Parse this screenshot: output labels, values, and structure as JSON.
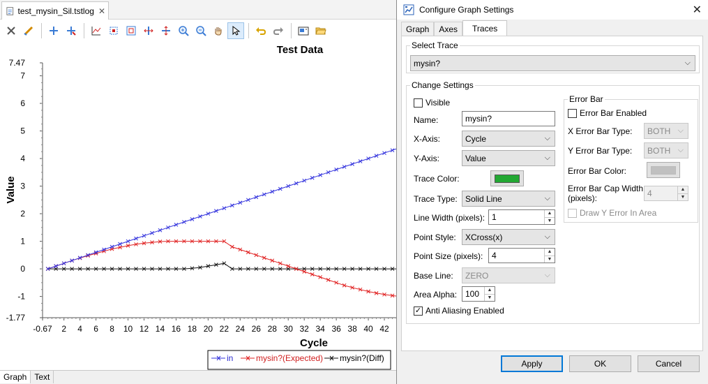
{
  "editor": {
    "tab_title": "test_mysin_Sil.tstlog",
    "bottom_tabs": [
      "Graph",
      "Text"
    ]
  },
  "toolbar": {
    "icons": [
      "tools-icon",
      "pen-icon",
      "add-point-icon",
      "remove-point-icon",
      "auto-scale-icon",
      "zoom-box-icon",
      "zoom-fit-icon",
      "zoom-x-icon",
      "zoom-y-icon",
      "zoom-in-icon",
      "zoom-out-icon",
      "pan-icon",
      "pointer-icon",
      "undo-icon",
      "redo-icon",
      "screenshot-icon",
      "open-folder-icon"
    ],
    "active": "pointer-icon"
  },
  "chart_data": {
    "type": "line",
    "title": "Test Data",
    "xlabel": "Cycle",
    "ylabel": "Value",
    "xlim": [
      -0.67,
      44
    ],
    "ylim": [
      -1.77,
      7.47
    ],
    "x_ticks": [
      "-0.67",
      "2",
      "4",
      "6",
      "8",
      "10",
      "12",
      "14",
      "16",
      "18",
      "20",
      "22",
      "24",
      "26",
      "28",
      "30",
      "32",
      "34",
      "36",
      "38",
      "40",
      "42",
      "4"
    ],
    "y_ticks": [
      "7.47",
      "7",
      "6",
      "5",
      "4",
      "3",
      "2",
      "1",
      "0",
      "-1",
      "-1.77"
    ],
    "legend_position": "bottom-right",
    "series": [
      {
        "name": "in",
        "color": "#3333dd",
        "marker": "x",
        "x": [
          0,
          1,
          2,
          3,
          4,
          5,
          6,
          7,
          8,
          9,
          10,
          11,
          12,
          13,
          14,
          15,
          16,
          17,
          18,
          19,
          20,
          21,
          22,
          23,
          24,
          25,
          26,
          27,
          28,
          29,
          30,
          31,
          32,
          33,
          34,
          35,
          36,
          37,
          38,
          39,
          40,
          41,
          42,
          43,
          44
        ],
        "y": [
          0,
          0.1,
          0.2,
          0.3,
          0.4,
          0.5,
          0.6,
          0.7,
          0.8,
          0.9,
          1,
          1.1,
          1.2,
          1.3,
          1.4,
          1.5,
          1.6,
          1.7,
          1.8,
          1.9,
          2,
          2.1,
          2.2,
          2.3,
          2.4,
          2.5,
          2.6,
          2.7,
          2.8,
          2.9,
          3,
          3.1,
          3.2,
          3.3,
          3.4,
          3.5,
          3.6,
          3.7,
          3.8,
          3.9,
          4,
          4.1,
          4.2,
          4.3,
          4.4
        ]
      },
      {
        "name": "mysin?(Expected)",
        "color": "#e02020",
        "marker": "x",
        "x": [
          0,
          1,
          2,
          3,
          4,
          5,
          6,
          7,
          8,
          9,
          10,
          11,
          12,
          13,
          14,
          15,
          16,
          17,
          18,
          19,
          20,
          21,
          22,
          23,
          24,
          25,
          26,
          27,
          28,
          29,
          30,
          31,
          32,
          33,
          34,
          35,
          36,
          37,
          38,
          39,
          40,
          41,
          42,
          43,
          44
        ],
        "y": [
          0,
          0.1,
          0.2,
          0.3,
          0.39,
          0.48,
          0.56,
          0.64,
          0.72,
          0.78,
          0.84,
          0.89,
          0.93,
          0.96,
          0.99,
          1,
          1,
          1,
          1,
          1,
          1,
          1,
          1,
          0.8,
          0.7,
          0.6,
          0.5,
          0.4,
          0.3,
          0.2,
          0.1,
          0,
          -0.1,
          -0.2,
          -0.3,
          -0.4,
          -0.5,
          -0.6,
          -0.68,
          -0.75,
          -0.82,
          -0.88,
          -0.93,
          -0.97,
          -1
        ]
      },
      {
        "name": "mysin?(Diff)",
        "color": "#111111",
        "marker": "x",
        "x": [
          0,
          1,
          2,
          3,
          4,
          5,
          6,
          7,
          8,
          9,
          10,
          11,
          12,
          13,
          14,
          15,
          16,
          17,
          18,
          19,
          20,
          21,
          22,
          23,
          24,
          25,
          26,
          27,
          28,
          29,
          30,
          31,
          32,
          33,
          34,
          35,
          36,
          37,
          38,
          39,
          40,
          41,
          42,
          43,
          44
        ],
        "y": [
          0,
          0,
          0,
          0,
          0,
          0,
          0,
          0,
          0,
          0,
          0,
          0,
          0,
          0,
          0,
          0,
          0,
          0,
          0.02,
          0.05,
          0.1,
          0.15,
          0.2,
          0,
          0,
          0,
          0,
          0,
          0,
          0,
          0,
          0,
          0,
          0,
          0,
          0,
          0,
          0,
          0,
          0,
          0,
          0,
          0,
          0,
          0
        ]
      }
    ]
  },
  "dialog": {
    "title": "Configure Graph Settings",
    "tabs": [
      "Graph",
      "Axes",
      "Traces"
    ],
    "active_tab": "Traces",
    "select_trace": {
      "title": "Select Trace",
      "value": "mysin?"
    },
    "change_settings": {
      "title": "Change Settings",
      "visible_label": "Visible",
      "visible_checked": false,
      "name_label": "Name:",
      "name_value": "mysin?",
      "x_axis_label": "X-Axis:",
      "x_axis_value": "Cycle",
      "y_axis_label": "Y-Axis:",
      "y_axis_value": "Value",
      "trace_color_label": "Trace Color:",
      "trace_color": "#22a833",
      "trace_type_label": "Trace Type:",
      "trace_type_value": "Solid Line",
      "line_width_label": "Line Width (pixels):",
      "line_width_value": "1",
      "point_style_label": "Point Style:",
      "point_style_value": "XCross(x)",
      "point_size_label": "Point Size (pixels):",
      "point_size_value": "4",
      "base_line_label": "Base Line:",
      "base_line_value": "ZERO",
      "area_alpha_label": "Area Alpha:",
      "area_alpha_value": "100",
      "anti_aliasing_label": "Anti Aliasing Enabled",
      "anti_aliasing_checked": true
    },
    "error_bar": {
      "title": "Error Bar",
      "enabled_label": "Error Bar Enabled",
      "enabled_checked": false,
      "x_type_label": "X Error Bar Type:",
      "x_type_value": "BOTH",
      "y_type_label": "Y Error Bar Type:",
      "y_type_value": "BOTH",
      "color_label": "Error Bar Color:",
      "color": "#c0c0c0",
      "cap_width_label_line1": "Error Bar Cap Width",
      "cap_width_label_line2": "(pixels):",
      "cap_width_value": "4",
      "draw_y_label": "Draw Y Error In Area",
      "draw_y_checked": false
    },
    "buttons": {
      "apply": "Apply",
      "ok": "OK",
      "cancel": "Cancel"
    }
  }
}
